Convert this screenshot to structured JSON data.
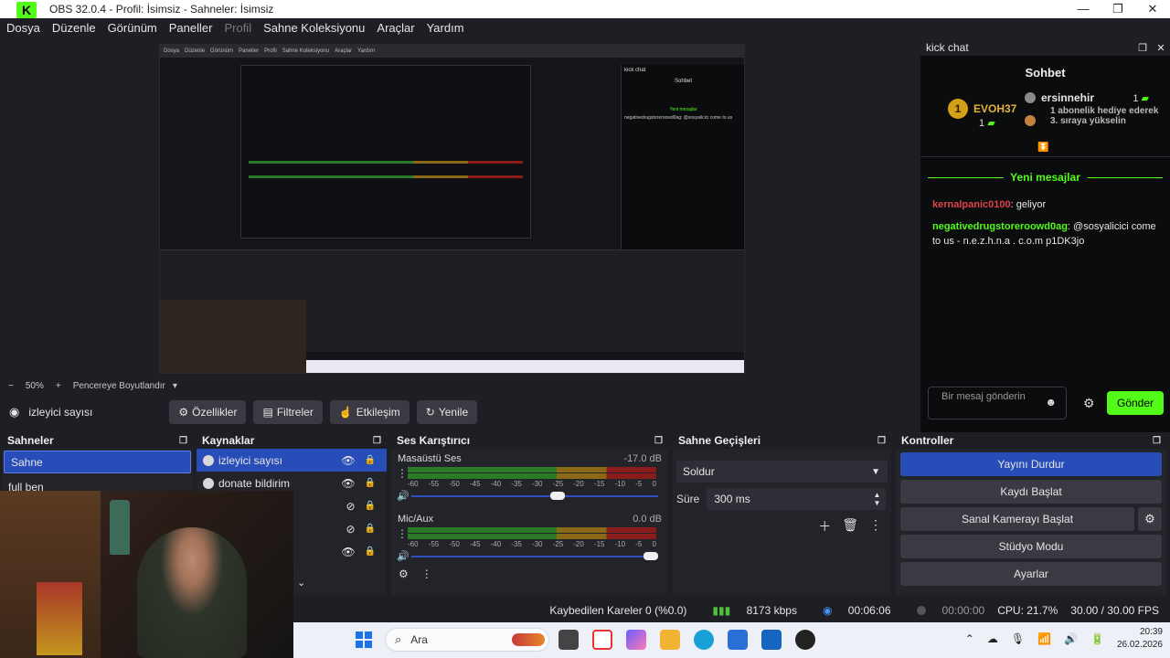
{
  "window": {
    "title": "OBS 32.0.4 - Profil: İsimsiz - Sahneler: İsimsiz",
    "controls": {
      "minimize": "—",
      "maximize": "❐",
      "close": "✕"
    }
  },
  "menu": [
    "Dosya",
    "Düzenle",
    "Görünüm",
    "Paneller",
    "Profil",
    "Sahne Koleksiyonu",
    "Araçlar",
    "Yardım"
  ],
  "preview": {
    "zoom": "50%",
    "zoom_minus": "−",
    "zoom_plus": "+",
    "fit_label": "Pencereye Boyutlandır",
    "nested": {
      "menu": [
        "Dosya",
        "Düzenle",
        "Görünüm",
        "Paneller",
        "Profil",
        "Sahne Koleksiyonu",
        "Araçlar",
        "Yardım"
      ],
      "chat_title": "kick chat",
      "chat_sub": "Sohbet",
      "new_msgs": "Yeni mesajlar",
      "msg": "negativedrugstoreroowd0ag: @sosyalicici come to us"
    }
  },
  "source_toolbar": {
    "source_name": "izleyici sayısı",
    "buttons": [
      {
        "icon": "⚙",
        "label": "Özellikler"
      },
      {
        "icon": "▤",
        "label": "Filtreler"
      },
      {
        "icon": "☝",
        "label": "Etkileşim"
      },
      {
        "icon": "↻",
        "label": "Yenile"
      }
    ]
  },
  "chat": {
    "panel_title": "kick chat",
    "heading": "Sohbet",
    "top_gifter": {
      "rank": "1",
      "name": "EVOH37",
      "count": "1"
    },
    "gifter2": {
      "name": "ersinnehir",
      "count": "1",
      "desc": "1 abonelik hediye ederek 3. sıraya yükselin"
    },
    "new_messages_label": "Yeni mesajlar",
    "messages": [
      {
        "user": "kernalpanic0100",
        "text": ": geliyor"
      },
      {
        "user": "negativedrugstoreroowd0ag",
        "text": ": @sosyalicici come to us - n.e.z.h.n.a . c.o.m p1DK3jo"
      }
    ],
    "input_placeholder": "Bir mesaj gönderin",
    "send_label": "Gönder"
  },
  "scenes": {
    "title": "Sahneler",
    "items": [
      "Sahne",
      "full ben"
    ]
  },
  "sources": {
    "title": "Kaynaklar",
    "items": [
      "izleyici sayısı",
      "donate bildirim"
    ]
  },
  "mixer": {
    "title": "Ses Karıştırıcı",
    "channels": [
      {
        "name": "Masaüstü Ses",
        "db": "-17.0 dB",
        "volume": 0.6
      },
      {
        "name": "Mic/Aux",
        "db": "0.0 dB",
        "volume": 1.0
      }
    ],
    "ticks": [
      "-60",
      "-55",
      "-50",
      "-45",
      "-40",
      "-35",
      "-30",
      "-25",
      "-20",
      "-15",
      "-10",
      "-5",
      "0"
    ]
  },
  "transitions": {
    "title": "Sahne Geçişleri",
    "selected": "Soldur",
    "duration_label": "Süre",
    "duration_value": "300 ms"
  },
  "controls": {
    "title": "Kontroller",
    "buttons": [
      "Yayını Durdur",
      "Kaydı Başlat",
      "Sanal Kamerayı Başlat",
      "Stüdyo Modu",
      "Ayarlar"
    ]
  },
  "status": {
    "dropped": "Kaybedilen Kareler 0 (%0.0)",
    "bitrate": "8173 kbps",
    "stream_time": "00:06:06",
    "rec_time": "00:00:00",
    "cpu": "CPU: 21.7%",
    "fps": "30.00 / 30.00 FPS"
  },
  "taskbar": {
    "search": "Ara",
    "time": "20:39",
    "date": "26.02.2026"
  },
  "colors": {
    "accent_blue": "#284cb8",
    "kick_green": "#53fc18",
    "username_red": "#e0424a"
  }
}
